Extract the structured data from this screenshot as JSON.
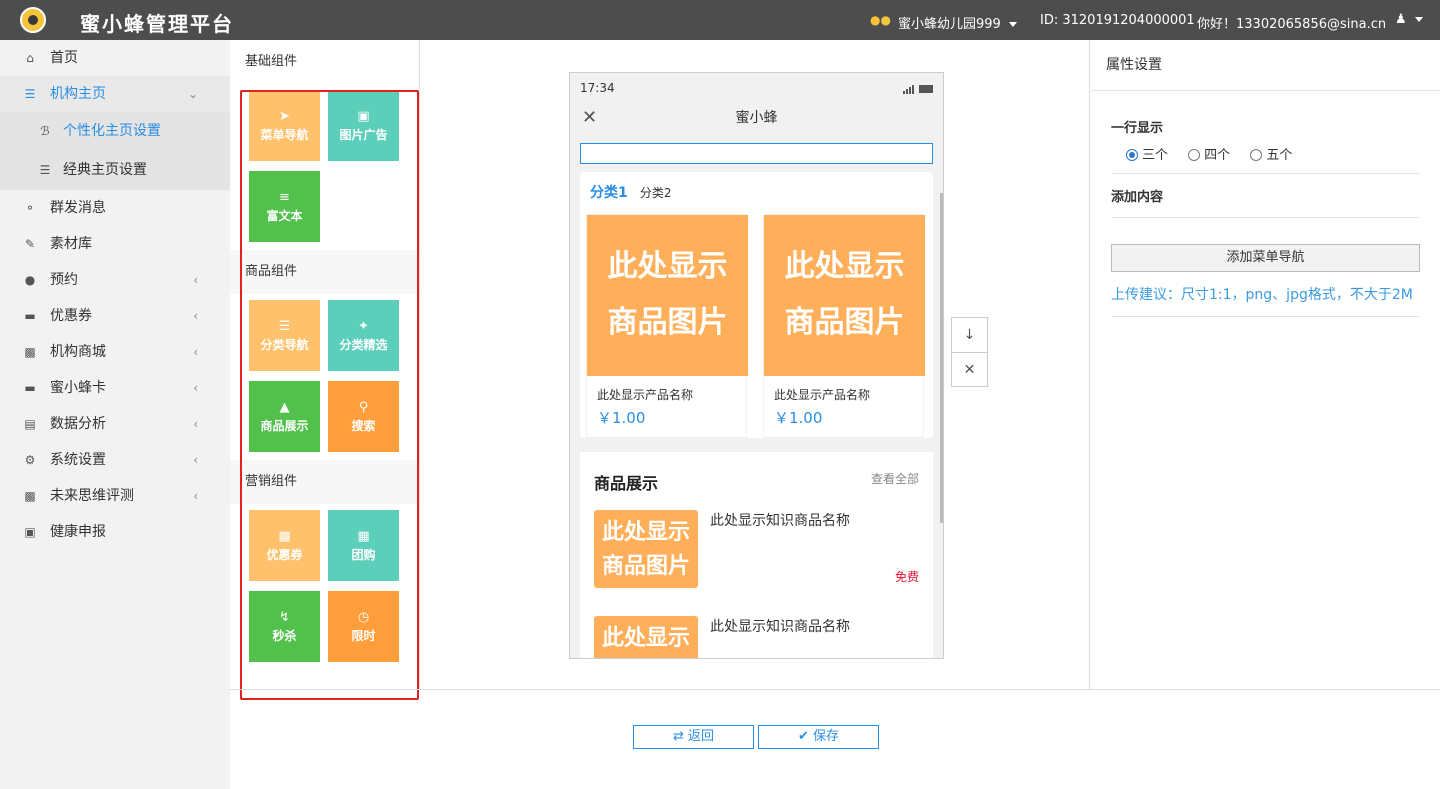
{
  "header": {
    "brand": "蜜小蜂管理平台",
    "org": "蜜小蜂幼儿园999",
    "id_text": "ID:  3120191204000001",
    "greeting": "你好！13302065856@sina.cn"
  },
  "sidebar": {
    "items": [
      {
        "label": "首页",
        "icon": "home-icon"
      },
      {
        "label": "机构主页",
        "icon": "list-icon"
      },
      {
        "label": "个性化主页设置",
        "icon": "ie-icon"
      },
      {
        "label": "经典主页设置",
        "icon": "list-icon"
      },
      {
        "label": "群发消息",
        "icon": "chat-icon"
      },
      {
        "label": "素材库",
        "icon": "edit-icon"
      },
      {
        "label": "预约",
        "icon": "users-icon"
      },
      {
        "label": "优惠券",
        "icon": "card-icon"
      },
      {
        "label": "机构商城",
        "icon": "building-icon"
      },
      {
        "label": "蜜小蜂卡",
        "icon": "card-icon"
      },
      {
        "label": "数据分析",
        "icon": "bar-chart-icon"
      },
      {
        "label": "系统设置",
        "icon": "gears-icon"
      },
      {
        "label": "未来思维评测",
        "icon": "building-icon"
      },
      {
        "label": "健康申报",
        "icon": "id-card-icon"
      }
    ]
  },
  "components": {
    "basic_title": "基础组件",
    "basic": [
      {
        "label": "菜单导航",
        "icon": "send-icon"
      },
      {
        "label": "图片广告",
        "icon": "image-icon"
      },
      {
        "label": "富文本",
        "icon": "text-icon"
      }
    ],
    "goods_title": "商品组件",
    "goods": [
      {
        "label": "分类导航",
        "icon": "list-icon"
      },
      {
        "label": "分类精选",
        "icon": "magic-icon"
      },
      {
        "label": "商品展示",
        "icon": "cap-icon"
      },
      {
        "label": "搜索",
        "icon": "search-icon"
      }
    ],
    "marketing_title": "营销组件",
    "marketing": [
      {
        "label": "优惠券",
        "icon": "ticket-icon"
      },
      {
        "label": "团购",
        "icon": "bag-icon"
      },
      {
        "label": "秒杀",
        "icon": "bolt-icon"
      },
      {
        "label": "限时",
        "icon": "clock-icon"
      }
    ]
  },
  "phone": {
    "time": "17:34",
    "title": "蜜小蜂",
    "tab_active": "分类1",
    "tab_other": "分类2",
    "product_img_line1": "此处显示",
    "product_img_line2": "商品图片",
    "products": [
      {
        "name": "此处显示产品名称",
        "price": "￥1.00"
      },
      {
        "name": "此处显示产品名称",
        "price": "￥1.00"
      }
    ],
    "show_title": "商品展示",
    "show_more": "查看全部",
    "knowledge": [
      {
        "name": "此处显示知识商品名称",
        "tag": "免费"
      },
      {
        "name": "此处显示知识商品名称",
        "tag": ""
      }
    ]
  },
  "props": {
    "title": "属性设置",
    "row_label": "一行显示",
    "options": [
      "三个",
      "四个",
      "五个"
    ],
    "selected": 0,
    "add_label": "添加内容",
    "add_button": "添加菜单导航",
    "tip": "上传建议：尺寸1:1，png、jpg格式，不大于2M"
  },
  "footer": {
    "back": "返回",
    "save": "保存"
  },
  "colors": {
    "accent": "#2a8ee5",
    "highlight_frame": "#e02222",
    "tile_orange_light": "#ffc16b",
    "tile_teal": "#5ccfbb",
    "tile_green": "#52c14c",
    "tile_orange": "#ff9e3b"
  }
}
